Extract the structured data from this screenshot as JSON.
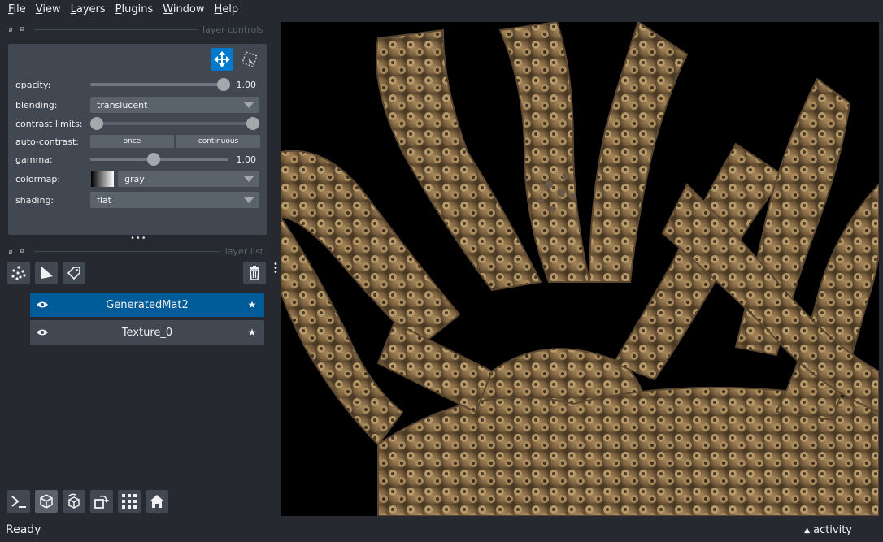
{
  "menu": {
    "items": [
      {
        "mnemonic": "F",
        "rest": "ile"
      },
      {
        "mnemonic": "V",
        "rest": "iew"
      },
      {
        "mnemonic": "L",
        "rest": "ayers"
      },
      {
        "mnemonic": "P",
        "rest": "lugins"
      },
      {
        "mnemonic": "W",
        "rest": "indow"
      },
      {
        "mnemonic": "H",
        "rest": "elp"
      }
    ]
  },
  "controls_dock": {
    "title": "layer controls"
  },
  "list_dock": {
    "title": "layer list"
  },
  "controls": {
    "opacity": {
      "label": "opacity:",
      "value_text": "1.00",
      "value": 1.0
    },
    "blending": {
      "label": "blending:",
      "value": "translucent"
    },
    "contrast": {
      "label": "contrast limits:"
    },
    "auto_contrast": {
      "label": "auto-contrast:",
      "once": "once",
      "continuous": "continuous"
    },
    "gamma": {
      "label": "gamma:",
      "value_text": "1.00"
    },
    "colormap": {
      "label": "colormap:",
      "value": "gray"
    },
    "shading": {
      "label": "shading:",
      "value": "flat"
    }
  },
  "layers": [
    {
      "name": "GeneratedMat2",
      "selected": true
    },
    {
      "name": "Texture_0",
      "selected": false
    }
  ],
  "colors": {
    "accent": "#007acc",
    "selected_layer": "#005b99",
    "panel": "#414851",
    "background": "#262930"
  },
  "status": {
    "text": "Ready",
    "activity": "activity"
  }
}
